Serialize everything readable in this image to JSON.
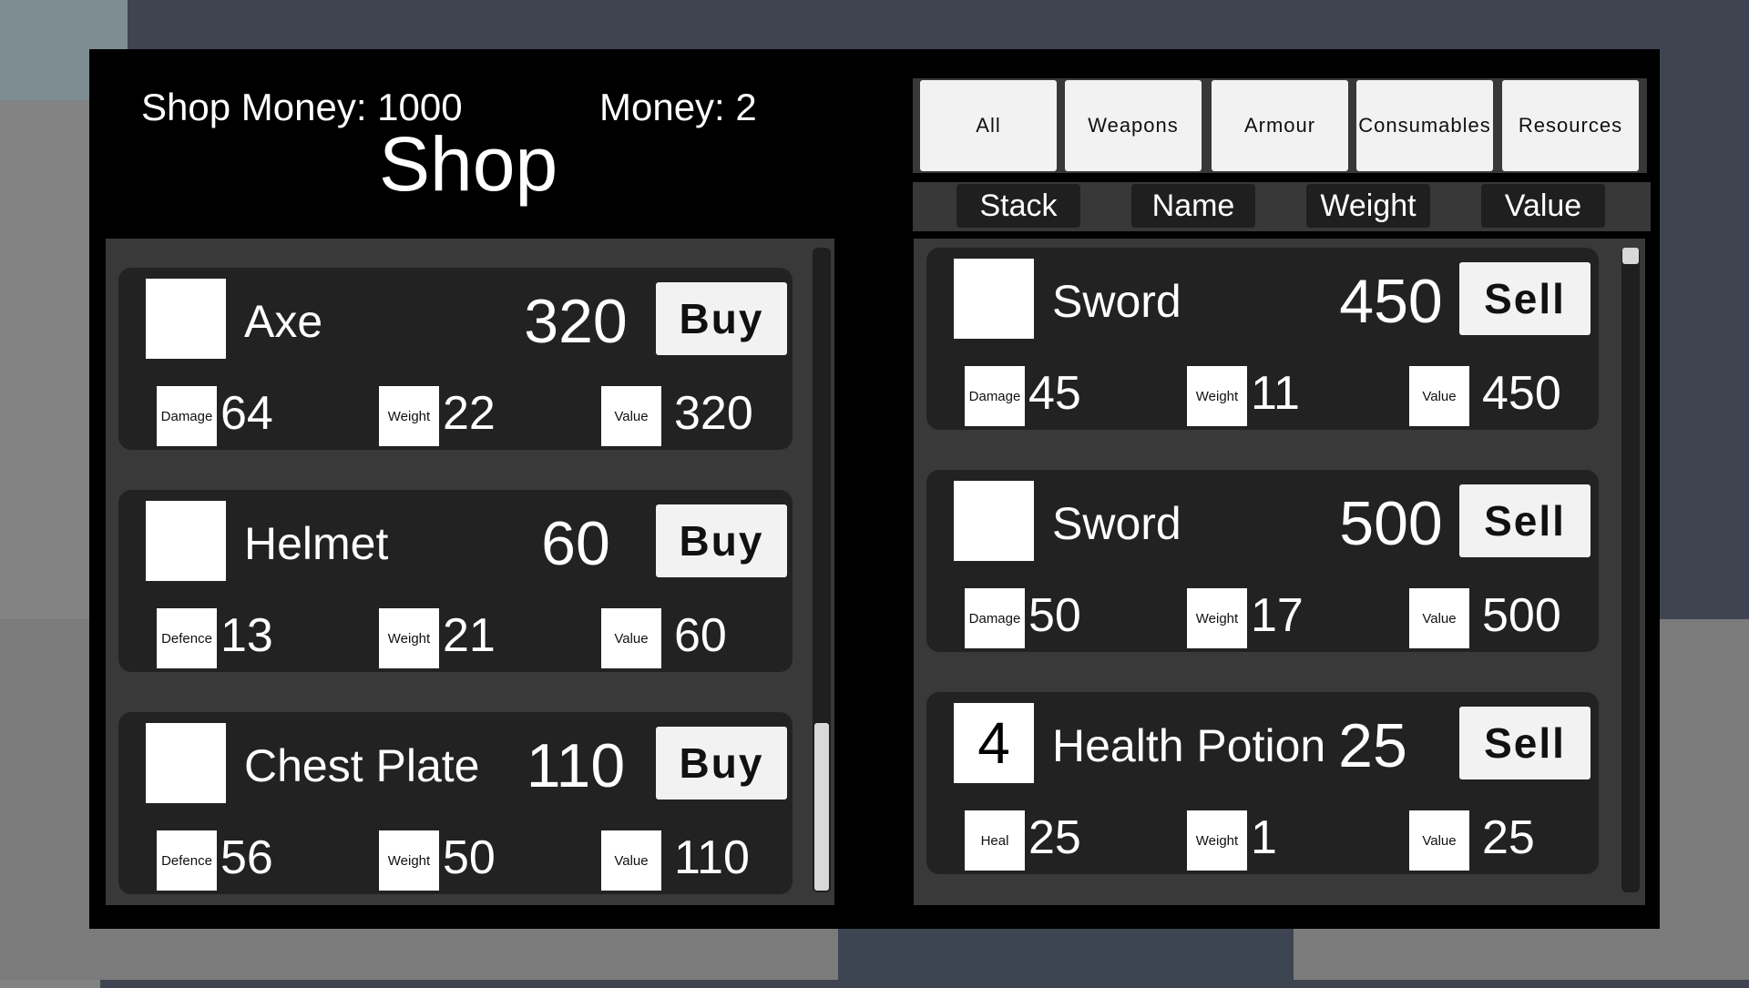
{
  "header": {
    "shop_money": "Shop Money: 1000",
    "money": "Money: 2",
    "title": "Shop"
  },
  "shop_items": [
    {
      "name": "Axe",
      "price": "320",
      "button": "Buy",
      "stats": [
        {
          "label": "Damage",
          "value": "64"
        },
        {
          "label": "Weight",
          "value": "22"
        },
        {
          "label": "Value",
          "value": "320"
        }
      ]
    },
    {
      "name": "Helmet",
      "price": "60",
      "button": "Buy",
      "stats": [
        {
          "label": "Defence",
          "value": "13"
        },
        {
          "label": "Weight",
          "value": "21"
        },
        {
          "label": "Value",
          "value": "60"
        }
      ]
    },
    {
      "name": "Chest Plate",
      "price": "110",
      "button": "Buy",
      "stats": [
        {
          "label": "Defence",
          "value": "56"
        },
        {
          "label": "Weight",
          "value": "50"
        },
        {
          "label": "Value",
          "value": "110"
        }
      ]
    }
  ],
  "tabs": [
    "All",
    "Weapons",
    "Armour",
    "Consumables",
    "Resources"
  ],
  "columns": [
    "Stack",
    "Name",
    "Weight",
    "Value"
  ],
  "inventory_items": [
    {
      "stack": "",
      "name": "Sword",
      "price": "450",
      "button": "Sell",
      "stats": [
        {
          "label": "Damage",
          "value": "45"
        },
        {
          "label": "Weight",
          "value": "11"
        },
        {
          "label": "Value",
          "value": "450"
        }
      ]
    },
    {
      "stack": "",
      "name": "Sword",
      "price": "500",
      "button": "Sell",
      "stats": [
        {
          "label": "Damage",
          "value": "50"
        },
        {
          "label": "Weight",
          "value": "17"
        },
        {
          "label": "Value",
          "value": "500"
        }
      ]
    },
    {
      "stack": "4",
      "name": "Health Potion",
      "price": "25",
      "button": "Sell",
      "stats": [
        {
          "label": "Heal",
          "value": "25"
        },
        {
          "label": "Weight",
          "value": "1"
        },
        {
          "label": "Value",
          "value": "25"
        }
      ]
    }
  ]
}
